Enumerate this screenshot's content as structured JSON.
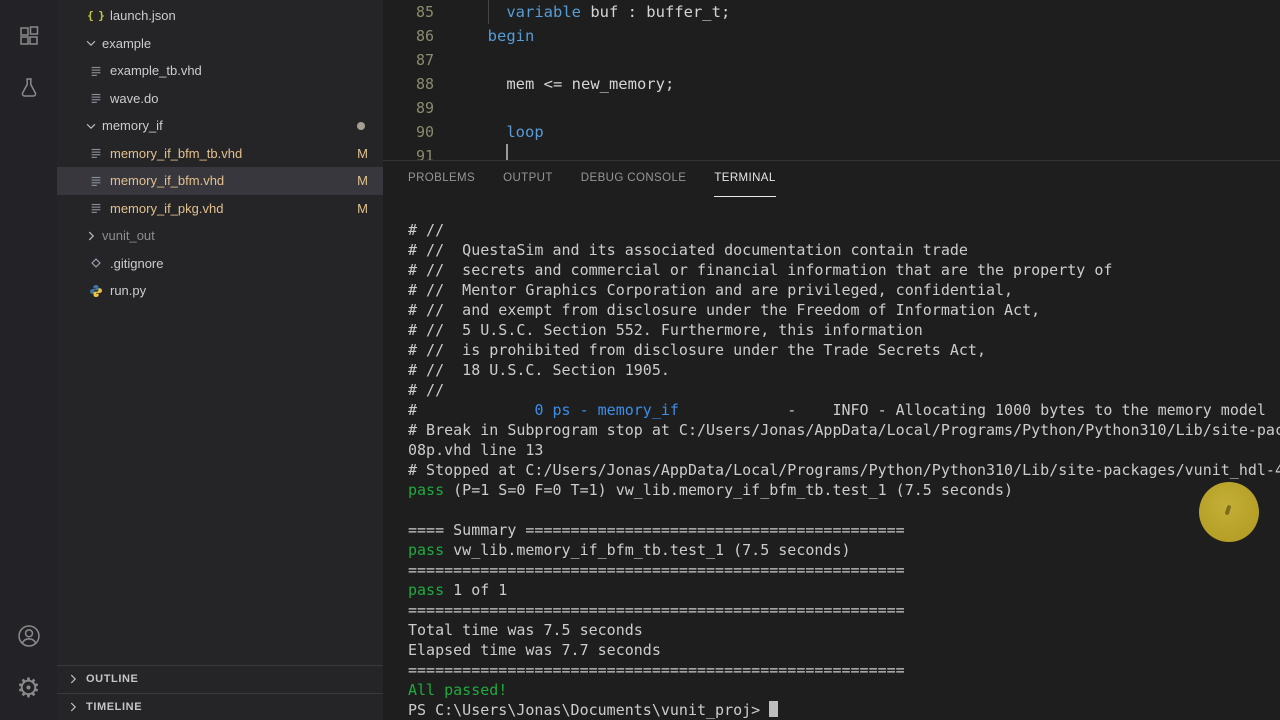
{
  "activity_bar": {
    "top_icons": [
      {
        "name": "extensions-icon"
      },
      {
        "name": "test-flask-icon"
      }
    ],
    "bottom_icons": [
      {
        "name": "account-icon"
      },
      {
        "name": "settings-gear-icon"
      }
    ]
  },
  "sidebar": {
    "tree": [
      {
        "label": "launch.json",
        "icon": "json-braces",
        "folder": false
      },
      {
        "label": "example",
        "icon": "chevron-down",
        "folder": true,
        "expanded": true
      },
      {
        "label": "example_tb.vhd",
        "icon": "file-lines",
        "folder": false
      },
      {
        "label": "wave.do",
        "icon": "file-lines",
        "folder": false
      },
      {
        "label": "memory_if",
        "icon": "chevron-down",
        "folder": true,
        "expanded": true,
        "dot": true
      },
      {
        "label": "memory_if_bfm_tb.vhd",
        "icon": "file-lines",
        "folder": false,
        "badge": "M",
        "modified": true
      },
      {
        "label": "memory_if_bfm.vhd",
        "icon": "file-lines",
        "folder": false,
        "badge": "M",
        "modified": true,
        "selected": true
      },
      {
        "label": "memory_if_pkg.vhd",
        "icon": "file-lines",
        "folder": false,
        "badge": "M",
        "modified": true
      },
      {
        "label": "vunit_out",
        "icon": "chevron-right",
        "folder": true,
        "expanded": false,
        "dim": true
      },
      {
        "label": ".gitignore",
        "icon": "git-diamond",
        "folder": false
      },
      {
        "label": "run.py",
        "icon": "python",
        "folder": false
      }
    ],
    "sections": [
      {
        "label": "OUTLINE"
      },
      {
        "label": "TIMELINE"
      }
    ]
  },
  "editor": {
    "lines": [
      {
        "num": "85",
        "segs": [
          {
            "t": "    "
          },
          {
            "t": "variable",
            "c": "kw"
          },
          {
            "t": " buf : buffer_t;"
          }
        ],
        "guides": [
          {
            "col": 2
          }
        ]
      },
      {
        "num": "86",
        "segs": [
          {
            "t": "  "
          },
          {
            "t": "begin",
            "c": "kw"
          }
        ],
        "guides": []
      },
      {
        "num": "87",
        "segs": [],
        "guides": []
      },
      {
        "num": "88",
        "segs": [
          {
            "t": "    mem <= new_memory;"
          }
        ],
        "guides": []
      },
      {
        "num": "89",
        "segs": [],
        "guides": []
      },
      {
        "num": "90",
        "segs": [
          {
            "t": "    "
          },
          {
            "t": "loop",
            "c": "kw"
          }
        ],
        "guides": []
      },
      {
        "num": "91",
        "segs": [],
        "guides": [
          {
            "col": 4,
            "active": true
          }
        ]
      }
    ]
  },
  "panel": {
    "tabs": [
      {
        "label": "PROBLEMS"
      },
      {
        "label": "OUTPUT"
      },
      {
        "label": "DEBUG CONSOLE"
      },
      {
        "label": "TERMINAL",
        "active": true
      }
    ]
  },
  "terminal": {
    "lines": [
      {
        "segs": [
          {
            "t": "# //"
          }
        ]
      },
      {
        "segs": [
          {
            "t": "# //  QuestaSim and its associated documentation contain trade"
          }
        ]
      },
      {
        "segs": [
          {
            "t": "# //  secrets and commercial or financial information that are the property of"
          }
        ]
      },
      {
        "segs": [
          {
            "t": "# //  Mentor Graphics Corporation and are privileged, confidential,"
          }
        ]
      },
      {
        "segs": [
          {
            "t": "# //  and exempt from disclosure under the Freedom of Information Act,"
          }
        ]
      },
      {
        "segs": [
          {
            "t": "# //  5 U.S.C. Section 552. Furthermore, this information"
          }
        ]
      },
      {
        "segs": [
          {
            "t": "# //  is prohibited from disclosure under the Trade Secrets Act,"
          }
        ]
      },
      {
        "segs": [
          {
            "t": "# //  18 U.S.C. Section 1905."
          }
        ]
      },
      {
        "segs": [
          {
            "t": "# //"
          }
        ]
      },
      {
        "segs": [
          {
            "t": "#             "
          },
          {
            "t": "0 ps - memory_if",
            "c": "blue"
          },
          {
            "t": "            -    INFO - Allocating 1000 bytes to the memory model"
          }
        ]
      },
      {
        "segs": [
          {
            "t": "# Break in Subprogram stop at C:/Users/Jonas/AppData/Local/Programs/Python/Python310/Lib/site-pac"
          }
        ]
      },
      {
        "segs": [
          {
            "t": "08p.vhd line 13"
          }
        ]
      },
      {
        "segs": [
          {
            "t": "# Stopped at C:/Users/Jonas/AppData/Local/Programs/Python/Python310/Lib/site-packages/vunit_hdl-4"
          }
        ]
      },
      {
        "segs": [
          {
            "t": "pass",
            "c": "green"
          },
          {
            "t": " (P=1 S=0 F=0 T=1) vw_lib.memory_if_bfm_tb.test_1 (7.5 seconds)"
          }
        ]
      },
      {
        "segs": []
      },
      {
        "segs": [
          {
            "t": "==== Summary =========================================="
          }
        ]
      },
      {
        "segs": [
          {
            "t": "pass",
            "c": "green"
          },
          {
            "t": " vw_lib.memory_if_bfm_tb.test_1 (7.5 seconds)"
          }
        ]
      },
      {
        "segs": [
          {
            "t": "======================================================="
          }
        ]
      },
      {
        "segs": [
          {
            "t": "pass",
            "c": "green"
          },
          {
            "t": " 1 of 1"
          }
        ]
      },
      {
        "segs": [
          {
            "t": "======================================================="
          }
        ]
      },
      {
        "segs": [
          {
            "t": "Total time was 7.5 seconds"
          }
        ]
      },
      {
        "segs": [
          {
            "t": "Elapsed time was 7.7 seconds"
          }
        ]
      },
      {
        "segs": [
          {
            "t": "======================================================="
          }
        ]
      },
      {
        "segs": [
          {
            "t": "All passed!",
            "c": "green"
          }
        ]
      },
      {
        "segs": [
          {
            "t": "PS C:\\Users\\Jonas\\Documents\\vunit_proj> "
          }
        ],
        "cursor": true
      }
    ]
  },
  "colors": {
    "keyword": "#569cd6",
    "terminal_green": "#1faa3e",
    "terminal_blue": "#3b8eea",
    "git_modified": "#e2c08d",
    "selection_bg": "#37373d",
    "cursor_highlight": "#c9b231"
  }
}
